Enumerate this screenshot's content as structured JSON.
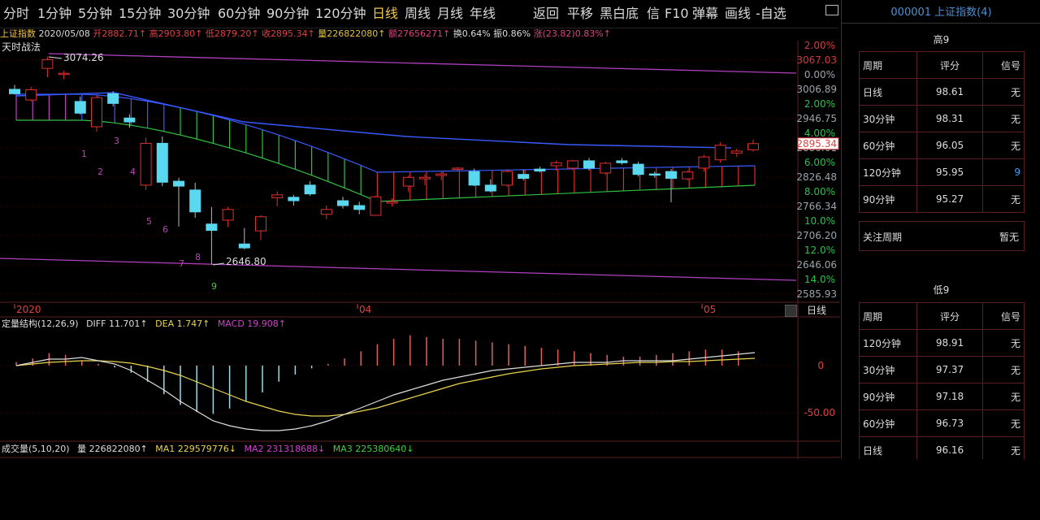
{
  "toolbar": {
    "periods": [
      "分时",
      "1分钟",
      "5分钟",
      "15分钟",
      "30分钟",
      "60分钟",
      "90分钟",
      "120分钟",
      "日线",
      "周线",
      "月线",
      "年线"
    ],
    "active": "日线",
    "actions": [
      "返回",
      "平移",
      "黑白底",
      "信",
      "F10",
      "弹幕",
      "画线",
      "-自选"
    ]
  },
  "info": {
    "name": "上证指数",
    "date": "2020/05/08",
    "open": "开2882.71↑",
    "high": "高2903.80↑",
    "low": "低2879.20↑",
    "close": "收2895.34↑",
    "volume": "量226822080↑",
    "amount": "额27656271↑",
    "turnover": "换0.64%",
    "amplitude": "振0.86%",
    "change": "涨(23.82)0.83%↑"
  },
  "strategy": "天时战法",
  "price_axis": {
    "levels": [
      {
        "pct": "2.00%",
        "price": "3067.03",
        "pct_color": "#d53a3a",
        "price_color": "#d53a3a"
      },
      {
        "pct": "0.00%",
        "price": "3006.89",
        "pct_color": "#9aa4aa",
        "price_color": "#9aa4aa"
      },
      {
        "pct": "2.00%",
        "price": "2946.75",
        "pct_color": "#2fbf4f",
        "price_color": "#9aa4aa"
      },
      {
        "pct": "4.00%",
        "price": "2886.61",
        "pct_color": "#2fbf4f",
        "price_color": "#9aa4aa"
      },
      {
        "pct": "6.00%",
        "price": "2826.48",
        "pct_color": "#2fbf4f",
        "price_color": "#9aa4aa"
      },
      {
        "pct": "8.00%",
        "price": "2766.34",
        "pct_color": "#2fbf4f",
        "price_color": "#9aa4aa"
      },
      {
        "pct": "10.0%",
        "price": "2706.20",
        "pct_color": "#2fbf4f",
        "price_color": "#9aa4aa"
      },
      {
        "pct": "12.0%",
        "price": "2646.06",
        "pct_color": "#2fbf4f",
        "price_color": "#9aa4aa"
      },
      {
        "pct": "14.0%",
        "price": "2585.93",
        "pct_color": "#2fbf4f",
        "price_color": "#9aa4aa"
      }
    ],
    "current": "2895.34"
  },
  "annotations": {
    "high": "3074.26",
    "low": "2646.80"
  },
  "wave_labels": [
    "1",
    "2",
    "3",
    "4",
    "5",
    "6",
    "7",
    "8",
    "9"
  ],
  "date_axis": [
    "2020",
    "04",
    "05"
  ],
  "macd": {
    "label": "定量结构(12,26,9)",
    "diff": "DIFF 11.701↑",
    "dea": "DEA 1.747↑",
    "macd": "MACD 19.908↑",
    "axis": [
      "0",
      "-50.00"
    ],
    "period_tag": "日线"
  },
  "volume": {
    "label": "成交量(5,10,20)",
    "vol": "量 226822080↑",
    "ma1": "MA1 229579776↓",
    "ma2": "MA2 231318688↓",
    "ma3": "MA3 225380640↓"
  },
  "right_panel": {
    "title": "000001 上证指数(4)",
    "high_title": "高9",
    "low_title": "低9",
    "headers": [
      "周期",
      "评分",
      "信号"
    ],
    "high_rows": [
      {
        "period": "日线",
        "score": "98.61",
        "signal": "无"
      },
      {
        "period": "30分钟",
        "score": "98.31",
        "signal": "无"
      },
      {
        "period": "60分钟",
        "score": "96.05",
        "signal": "无"
      },
      {
        "period": "120分钟",
        "score": "95.95",
        "signal": "9"
      },
      {
        "period": "90分钟",
        "score": "95.27",
        "signal": "无"
      }
    ],
    "follow_label": "关注周期",
    "follow_value": "暂无",
    "low_rows": [
      {
        "period": "120分钟",
        "score": "98.91",
        "signal": "无"
      },
      {
        "period": "30分钟",
        "score": "97.37",
        "signal": "无"
      },
      {
        "period": "90分钟",
        "score": "97.18",
        "signal": "无"
      },
      {
        "period": "60分钟",
        "score": "96.73",
        "signal": "无"
      },
      {
        "period": "日线",
        "score": "96.16",
        "signal": "无"
      }
    ]
  },
  "chart_data": {
    "type": "candlestick",
    "title": "上证指数",
    "ylim": [
      2585.93,
      3087
    ],
    "candles": [
      {
        "o": 3007,
        "h": 3016,
        "l": 2996,
        "c": 2998
      },
      {
        "o": 2985,
        "h": 3012,
        "l": 2982,
        "c": 3006
      },
      {
        "o": 3050,
        "h": 3074.26,
        "l": 3032,
        "c": 3068
      },
      {
        "o": 3038,
        "h": 3045,
        "l": 3028,
        "c": 3040
      },
      {
        "o": 2982,
        "h": 2992,
        "l": 2955,
        "c": 2958
      },
      {
        "o": 2930,
        "h": 2995,
        "l": 2920,
        "c": 2990
      },
      {
        "o": 2998,
        "h": 3003,
        "l": 2972,
        "c": 2978
      },
      {
        "o": 2948,
        "h": 2956,
        "l": 2928,
        "c": 2940
      },
      {
        "o": 2810,
        "h": 2908,
        "l": 2800,
        "c": 2896
      },
      {
        "o": 2896,
        "h": 2910,
        "l": 2808,
        "c": 2816
      },
      {
        "o": 2818,
        "h": 2825,
        "l": 2725,
        "c": 2808
      },
      {
        "o": 2800,
        "h": 2815,
        "l": 2743,
        "c": 2755
      },
      {
        "o": 2730,
        "h": 2765,
        "l": 2646.8,
        "c": 2717
      },
      {
        "o": 2738,
        "h": 2765,
        "l": 2724,
        "c": 2760
      },
      {
        "o": 2689,
        "h": 2722,
        "l": 2678,
        "c": 2681
      },
      {
        "o": 2716,
        "h": 2748,
        "l": 2697,
        "c": 2745
      },
      {
        "o": 2784,
        "h": 2797,
        "l": 2767,
        "c": 2790
      },
      {
        "o": 2785,
        "h": 2790,
        "l": 2768,
        "c": 2778
      },
      {
        "o": 2810,
        "h": 2818,
        "l": 2788,
        "c": 2792
      },
      {
        "o": 2750,
        "h": 2768,
        "l": 2740,
        "c": 2760
      },
      {
        "o": 2778,
        "h": 2786,
        "l": 2762,
        "c": 2768
      },
      {
        "o": 2768,
        "h": 2776,
        "l": 2750,
        "c": 2760
      },
      {
        "o": 2748,
        "h": 2788,
        "l": 2747,
        "c": 2786
      },
      {
        "o": 2773,
        "h": 2783,
        "l": 2766,
        "c": 2776
      },
      {
        "o": 2808,
        "h": 2830,
        "l": 2796,
        "c": 2826
      },
      {
        "o": 2823,
        "h": 2833,
        "l": 2810,
        "c": 2826
      },
      {
        "o": 2830,
        "h": 2837,
        "l": 2820,
        "c": 2833
      },
      {
        "o": 2843,
        "h": 2847,
        "l": 2838,
        "c": 2845
      },
      {
        "o": 2838,
        "h": 2844,
        "l": 2808,
        "c": 2810
      },
      {
        "o": 2810,
        "h": 2822,
        "l": 2795,
        "c": 2798
      },
      {
        "o": 2810,
        "h": 2842,
        "l": 2807,
        "c": 2838
      },
      {
        "o": 2832,
        "h": 2842,
        "l": 2820,
        "c": 2824
      },
      {
        "o": 2843,
        "h": 2848,
        "l": 2836,
        "c": 2839
      },
      {
        "o": 2850,
        "h": 2860,
        "l": 2840,
        "c": 2856
      },
      {
        "o": 2845,
        "h": 2862,
        "l": 2841,
        "c": 2860
      },
      {
        "o": 2860,
        "h": 2866,
        "l": 2840,
        "c": 2845
      },
      {
        "o": 2835,
        "h": 2858,
        "l": 2831,
        "c": 2855
      },
      {
        "o": 2860,
        "h": 2866,
        "l": 2852,
        "c": 2856
      },
      {
        "o": 2853,
        "h": 2858,
        "l": 2828,
        "c": 2832
      },
      {
        "o": 2833,
        "h": 2838,
        "l": 2825,
        "c": 2831
      },
      {
        "o": 2838,
        "h": 2843,
        "l": 2775,
        "c": 2824
      },
      {
        "o": 2823,
        "h": 2840,
        "l": 2820,
        "c": 2837
      },
      {
        "o": 2845,
        "h": 2872,
        "l": 2838,
        "c": 2868
      },
      {
        "o": 2862,
        "h": 2898,
        "l": 2856,
        "c": 2892
      },
      {
        "o": 2876,
        "h": 2885,
        "l": 2868,
        "c": 2880
      },
      {
        "o": 2882.71,
        "h": 2903.8,
        "l": 2879.2,
        "c": 2895.34
      }
    ]
  }
}
